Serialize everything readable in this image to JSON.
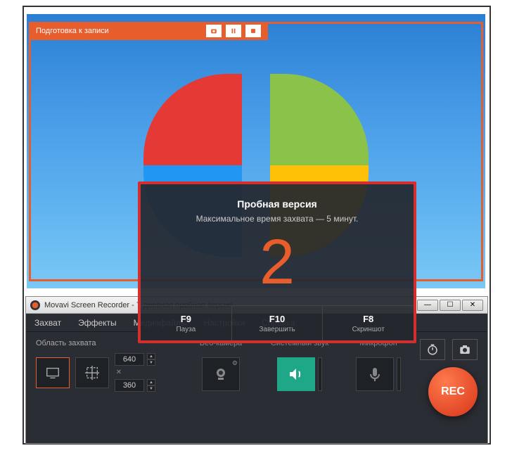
{
  "overlay": {
    "title": "Подготовка к записи"
  },
  "countdown": {
    "trial_title": "Пробная версия",
    "limit_text": "Максимальное время захвата — 5 минут.",
    "number": "2",
    "hotkeys": [
      {
        "key": "F9",
        "label": "Пауза"
      },
      {
        "key": "F10",
        "label": "Завершить"
      },
      {
        "key": "F8",
        "label": "Скриншот"
      }
    ]
  },
  "app": {
    "title": "Movavi Screen Recorder - 7-дневная пробная версия",
    "menu": [
      "Захват",
      "Эффекты",
      "Медиафайлы",
      "Настройки",
      "Справка"
    ],
    "capture_label": "Область захвата",
    "width": "640",
    "height": "360",
    "sources": {
      "webcam": "Веб-камера",
      "system": "Системный звук",
      "mic": "Микрофон"
    },
    "rec": "REC"
  }
}
